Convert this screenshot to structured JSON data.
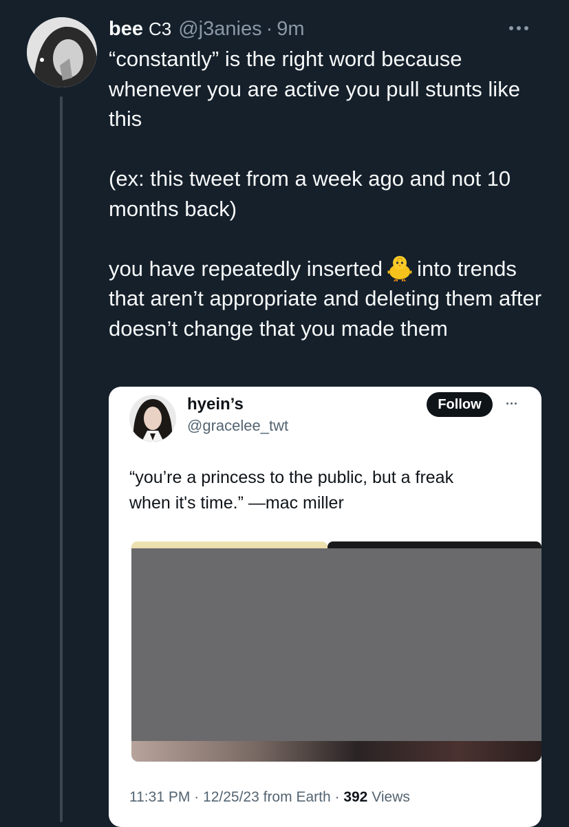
{
  "tweet": {
    "display_name": "bee",
    "name_glyph": "C3",
    "handle": "@j3anies",
    "separator": "·",
    "time": "9m",
    "paragraphs": [
      "“constantly” is the right word because whenever you are active you pull stunts like this",
      "(ex: this tweet from a week ago and not 10 months back)"
    ],
    "para3_before": "you have repeatedly inserted",
    "para3_emoji": "chick-emoji",
    "para3_after": "into trends that aren’t appropriate and deleting them after doesn’t change that you made them"
  },
  "embedded": {
    "name": "hyein’s",
    "handle": "@gracelee_twt",
    "follow_label": "Follow",
    "line1": "“you’re a princess to the public, but a freak",
    "line2": "when it's time.” —mac miller",
    "time": "11:31 PM",
    "sep1": "·",
    "date": "12/25/23",
    "source": "from Earth",
    "sep2": "·",
    "views_count": "392",
    "views_label": "Views"
  },
  "colors": {
    "background": "#15202b",
    "text_primary": "#f7f9f9",
    "text_secondary": "#8b98a5",
    "card_background": "#ffffff",
    "follow_button": "#0f1419",
    "redaction": "#6a6a6c"
  },
  "icons": [
    "more-icon",
    "chick-emoji",
    "embedded-more-icon"
  ]
}
